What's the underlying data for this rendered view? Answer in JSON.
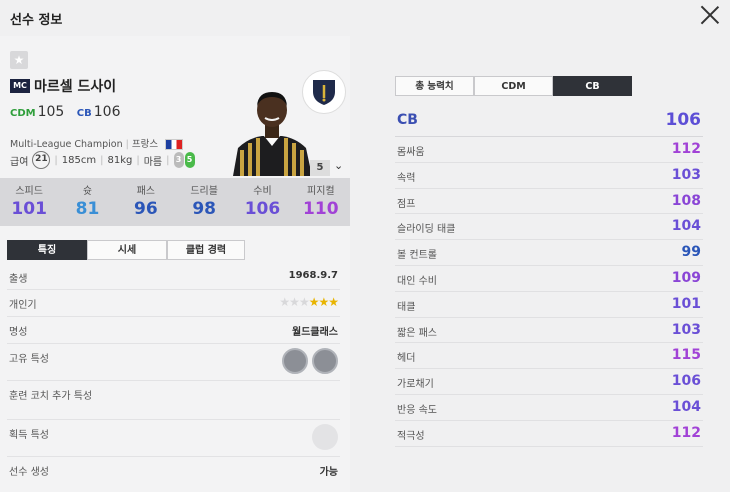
{
  "window": {
    "title": "선수 정보"
  },
  "player": {
    "season_badge": "MC",
    "name": "마르셀 드사이",
    "positions": [
      {
        "label": "CDM",
        "value": "105",
        "color": "#2e9e3a"
      },
      {
        "label": "CB",
        "value": "106",
        "color": "#2b56b8"
      }
    ],
    "season_name": "Multi-League Champion",
    "nationality": "프랑스",
    "salary_label": "급여",
    "salary": "21",
    "height": "185cm",
    "weight": "81kg",
    "body_type": "마름",
    "weak_foot": "3",
    "strong_foot": "5",
    "level": "5",
    "club_icon": "shield-logo-icon"
  },
  "stats": [
    {
      "label": "스피드",
      "value": "101",
      "color": "#6a4fd6"
    },
    {
      "label": "슛",
      "value": "81",
      "color": "#3a8fd6"
    },
    {
      "label": "패스",
      "value": "96",
      "color": "#2b56b8"
    },
    {
      "label": "드리블",
      "value": "98",
      "color": "#2b56b8"
    },
    {
      "label": "수비",
      "value": "106",
      "color": "#6a4fd6"
    },
    {
      "label": "피지컬",
      "value": "110",
      "color": "#a142d6"
    }
  ],
  "left_tabs": [
    "특징",
    "시세",
    "클럽 경력"
  ],
  "details": {
    "birth_label": "출생",
    "birth": "1968.9.7",
    "popularity_label": "개인기",
    "popularity_stars": 3,
    "popularity_max": 6,
    "fame_label": "명성",
    "fame": "월드클래스",
    "traits_label": "고유 특성",
    "coach_label": "훈련 코치 추가 특성",
    "acquired_label": "획득 특성",
    "generate_label": "선수 생성",
    "generate": "가능"
  },
  "right_tabs": [
    "총 능력치",
    "CDM",
    "CB"
  ],
  "position_detail": {
    "label": "CB",
    "value": "106"
  },
  "attributes": [
    {
      "label": "몸싸움",
      "value": "112",
      "color": "#a142d6"
    },
    {
      "label": "속력",
      "value": "103",
      "color": "#6a4fd6"
    },
    {
      "label": "점프",
      "value": "108",
      "color": "#8a45d6"
    },
    {
      "label": "슬라이딩 태클",
      "value": "104",
      "color": "#6a4fd6"
    },
    {
      "label": "볼 컨트롤",
      "value": "99",
      "color": "#2b56b8"
    },
    {
      "label": "대인 수비",
      "value": "109",
      "color": "#8a45d6"
    },
    {
      "label": "태클",
      "value": "101",
      "color": "#6a4fd6"
    },
    {
      "label": "짧은 패스",
      "value": "103",
      "color": "#6a4fd6"
    },
    {
      "label": "헤더",
      "value": "115",
      "color": "#a142d6"
    },
    {
      "label": "가로채기",
      "value": "106",
      "color": "#6a4fd6"
    },
    {
      "label": "반응 속도",
      "value": "104",
      "color": "#6a4fd6"
    },
    {
      "label": "적극성",
      "value": "112",
      "color": "#a142d6"
    }
  ]
}
